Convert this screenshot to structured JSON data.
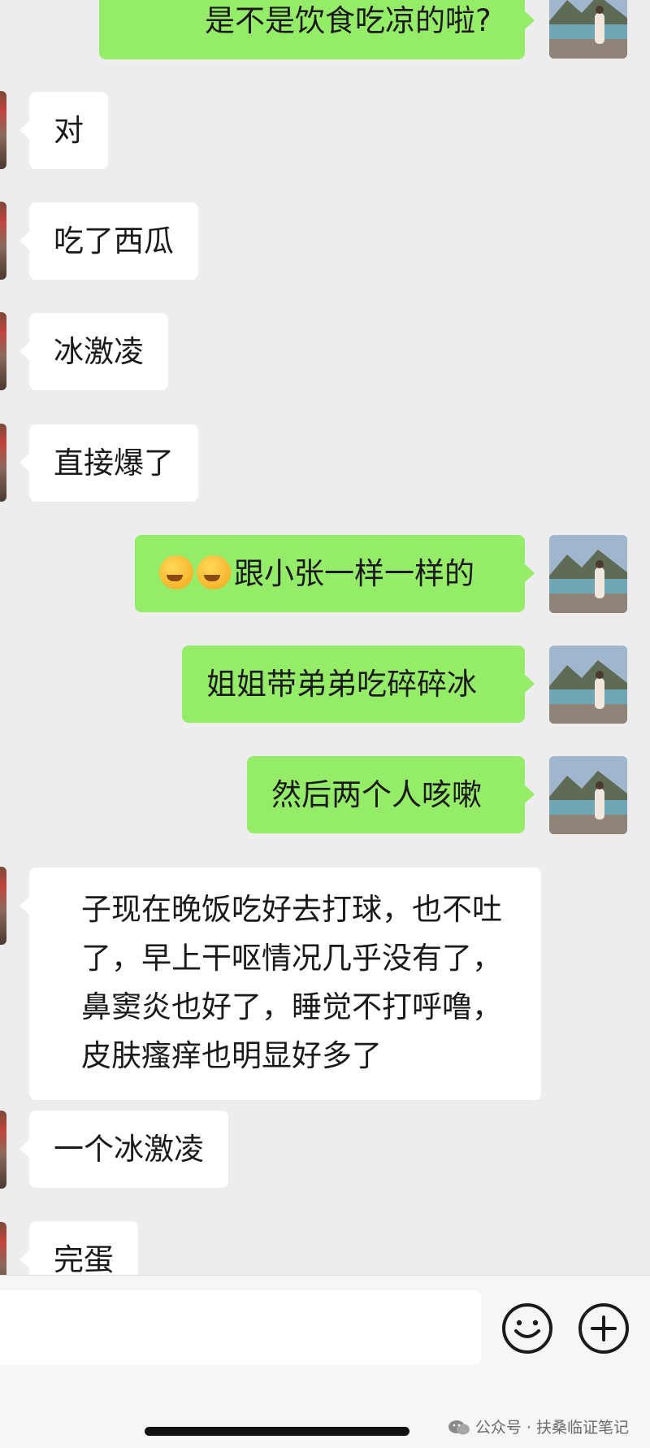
{
  "messages": [
    {
      "side": "out",
      "text": "是不是饮食吃凉的啦?"
    },
    {
      "side": "in",
      "text": "对"
    },
    {
      "side": "in",
      "text": "吃了西瓜"
    },
    {
      "side": "in",
      "text": "冰激凌"
    },
    {
      "side": "in",
      "text": "直接爆了"
    },
    {
      "side": "out",
      "text": "跟小张一样一样的",
      "emoji": "facepalm-crying-emoji x2"
    },
    {
      "side": "out",
      "text": "姐姐带弟弟吃碎碎冰"
    },
    {
      "side": "out",
      "text": "然后两个人咳嗽"
    },
    {
      "side": "in",
      "text": "子现在晚饭吃好去打球，也不吐了，早上干呕情况几乎没有了，鼻窦炎也好了，睡觉不打呼噜，皮肤瘙痒也明显好多了"
    },
    {
      "side": "in",
      "text": "一个冰激凌"
    },
    {
      "side": "in",
      "text": "完蛋"
    }
  ],
  "input_bar": {
    "emoji_button_icon": "smiley-face-icon",
    "more_button_icon": "plus-circle-icon"
  },
  "watermark": {
    "text": "公众号 · 扶桑临证笔记",
    "icon": "wechat-icon"
  },
  "colors": {
    "background": "#ededed",
    "outgoing_bubble": "#95ec69",
    "incoming_bubble": "#ffffff"
  }
}
